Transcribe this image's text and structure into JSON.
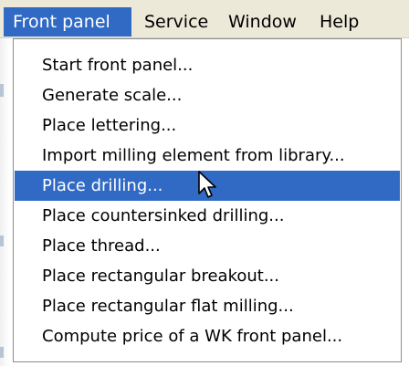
{
  "menubar": {
    "items": [
      {
        "label": "Front panel",
        "active": true
      },
      {
        "label": "Service",
        "active": false
      },
      {
        "label": "Window",
        "active": false
      },
      {
        "label": "Help",
        "active": false
      }
    ]
  },
  "dropdown": {
    "items": [
      {
        "label": "Start front panel..."
      },
      {
        "label": "Generate scale..."
      },
      {
        "label": "Place lettering..."
      },
      {
        "label": "Import milling element from library..."
      },
      {
        "label": "Place drilling...",
        "highlighted": true
      },
      {
        "label": "Place countersinked drilling..."
      },
      {
        "label": "Place thread..."
      },
      {
        "label": "Place rectangular breakout..."
      },
      {
        "label": "Place rectangular flat milling..."
      },
      {
        "label": "Compute price of a WK front panel..."
      }
    ]
  },
  "cursor": {
    "icon": "arrow-pointer-icon"
  },
  "colors": {
    "menubar_bg": "#ece9d8",
    "highlight_bg": "#316ac5",
    "highlight_text": "#ffffff",
    "menu_bg": "#ffffff"
  }
}
